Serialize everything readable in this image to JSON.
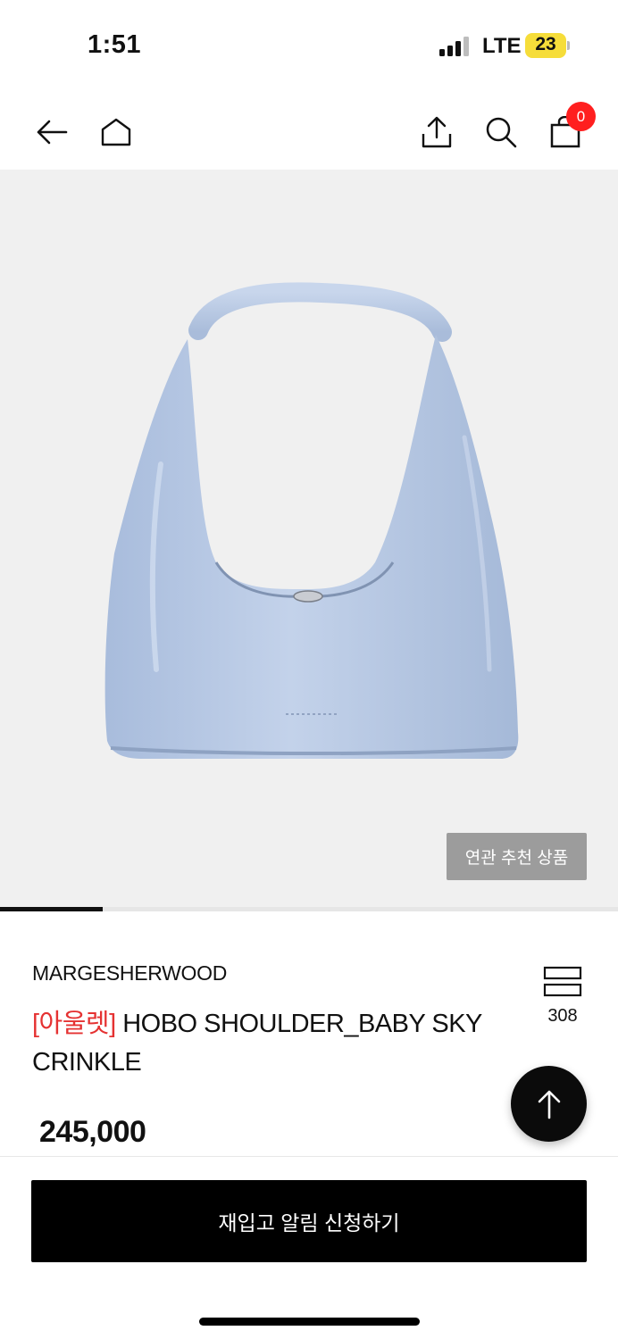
{
  "status_bar": {
    "time": "1:51",
    "network": "LTE",
    "battery": "23"
  },
  "nav": {
    "back_icon": "arrow-left-icon",
    "home_icon": "home-icon",
    "share_icon": "share-icon",
    "search_icon": "search-icon",
    "cart_icon": "shopping-bag-icon",
    "cart_count": "0"
  },
  "gallery": {
    "related_label": "연관 추천 상품",
    "current_index": 1,
    "image_fraction": 0.166
  },
  "product": {
    "brand": "MARGESHERWOOD",
    "tag": "[아울렛]",
    "name": "HOBO SHOULDER_BABY SKY CRINKLE",
    "price": "245,000",
    "like_count": "308"
  },
  "cta": {
    "label": "재입고 알림 신청하기"
  },
  "colors": {
    "accent_red": "#e53232",
    "badge_red": "#ff1f1f",
    "bag_blue": "#b7c8e3",
    "cta_black": "#000000"
  }
}
